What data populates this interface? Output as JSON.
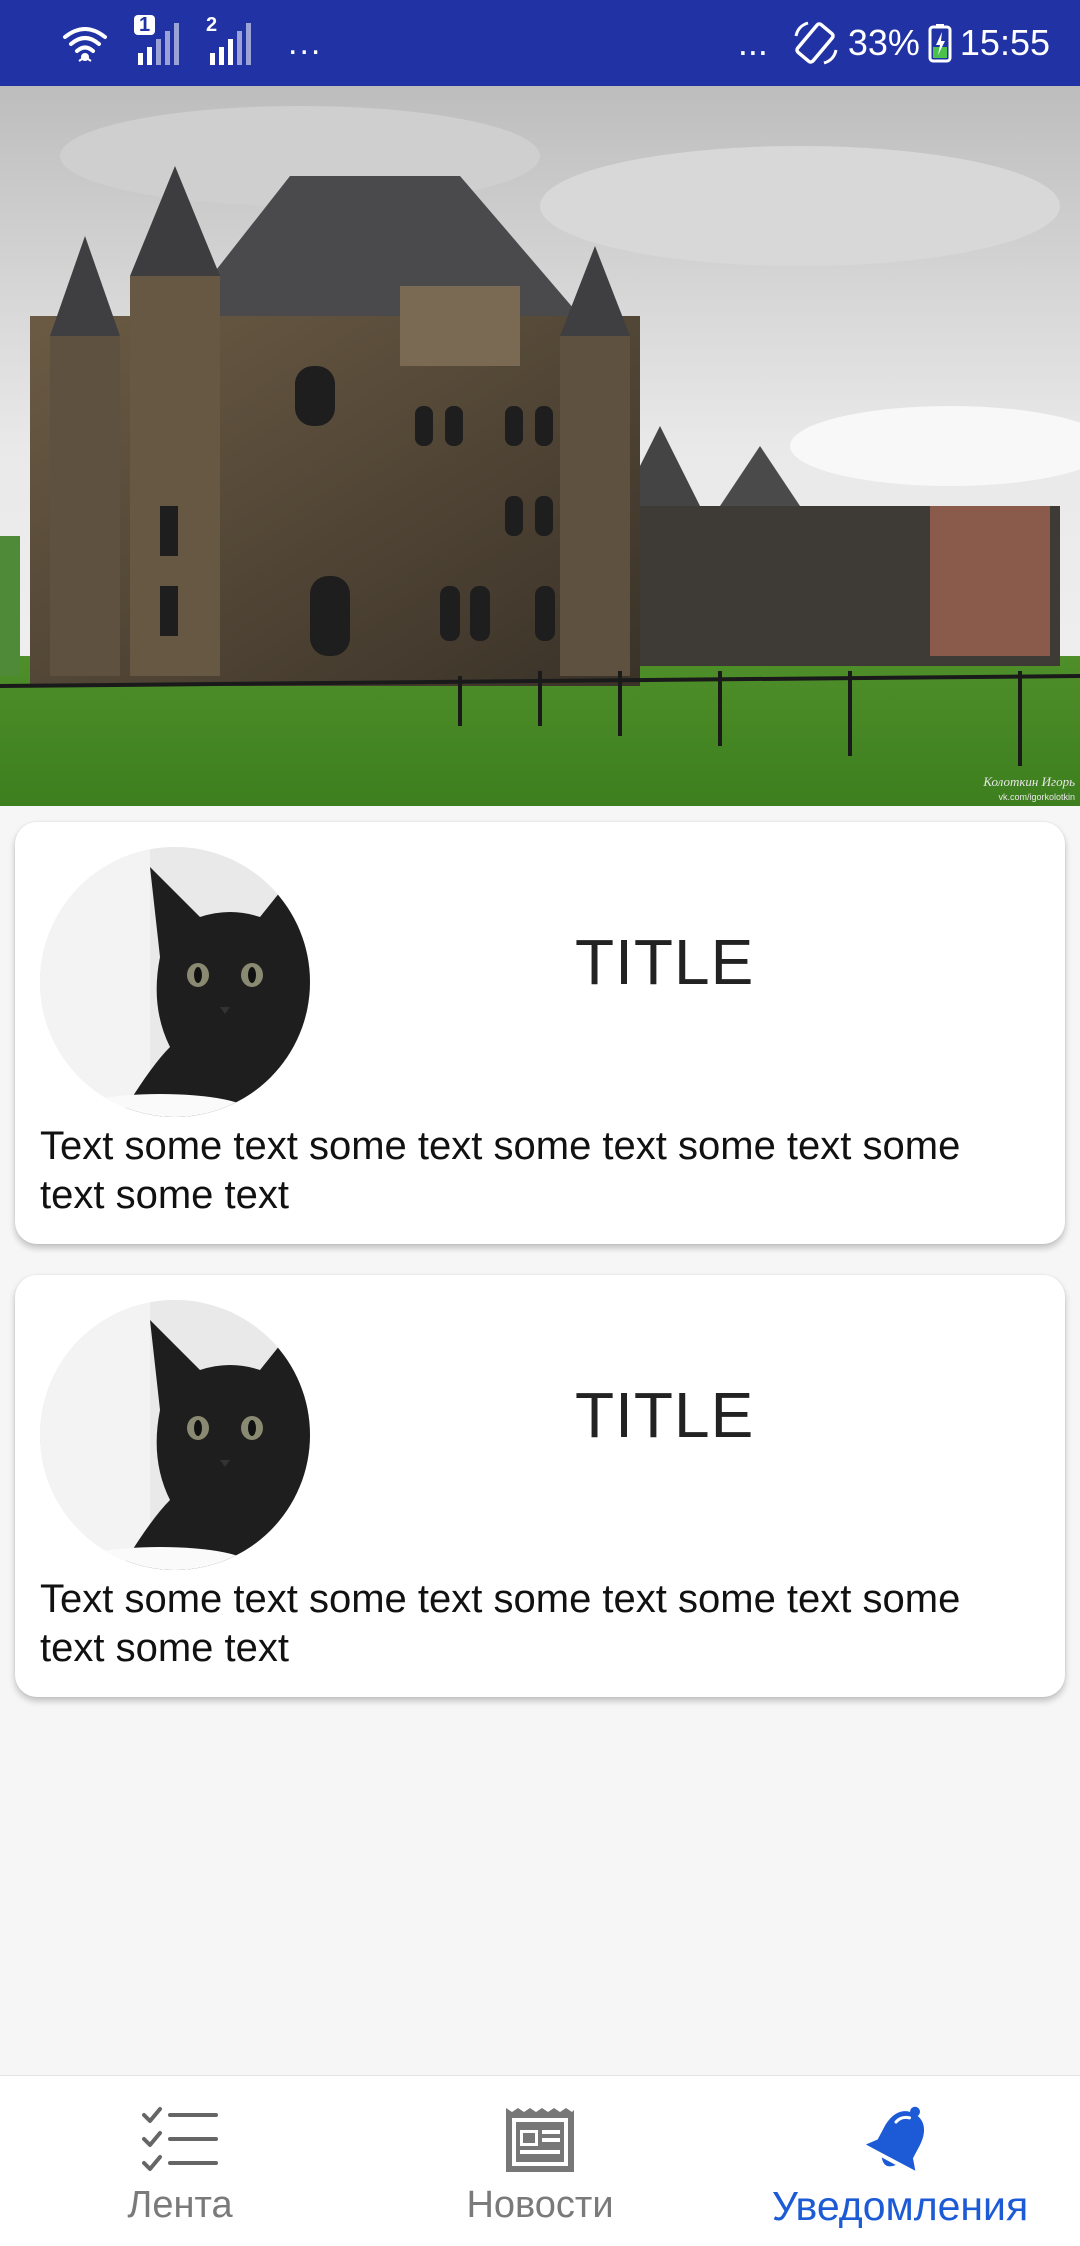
{
  "status_bar": {
    "sim1_label": "1",
    "sim2_label": "2",
    "left_dots": "...",
    "right_dots": "...",
    "battery_percent": "33%",
    "time": "15:55",
    "background_color": "#2132a4",
    "icons": [
      "wifi-icon",
      "signal-sim1-icon",
      "signal-sim2-icon",
      "rotate-icon",
      "battery-charging-icon"
    ]
  },
  "hero": {
    "image": "castle-photo",
    "watermark_line1": "Колоткин Игорь",
    "watermark_line2": "vk.com/igorkolotkin"
  },
  "cards": [
    {
      "avatar": "black-cat-photo",
      "title": "TITLE",
      "text": "Text some text some text some text some text some text some text"
    },
    {
      "avatar": "black-cat-photo",
      "title": "TITLE",
      "text": "Text some text some text some text some text some text some text"
    }
  ],
  "bottom_nav": {
    "items": [
      {
        "label": "Лента",
        "icon": "checklist-icon",
        "active": false
      },
      {
        "label": "Новости",
        "icon": "newspaper-icon",
        "active": false
      },
      {
        "label": "Уведомления",
        "icon": "bell-icon",
        "active": true
      }
    ],
    "active_color": "#1d5bd6",
    "inactive_color": "#7a7a7a"
  }
}
